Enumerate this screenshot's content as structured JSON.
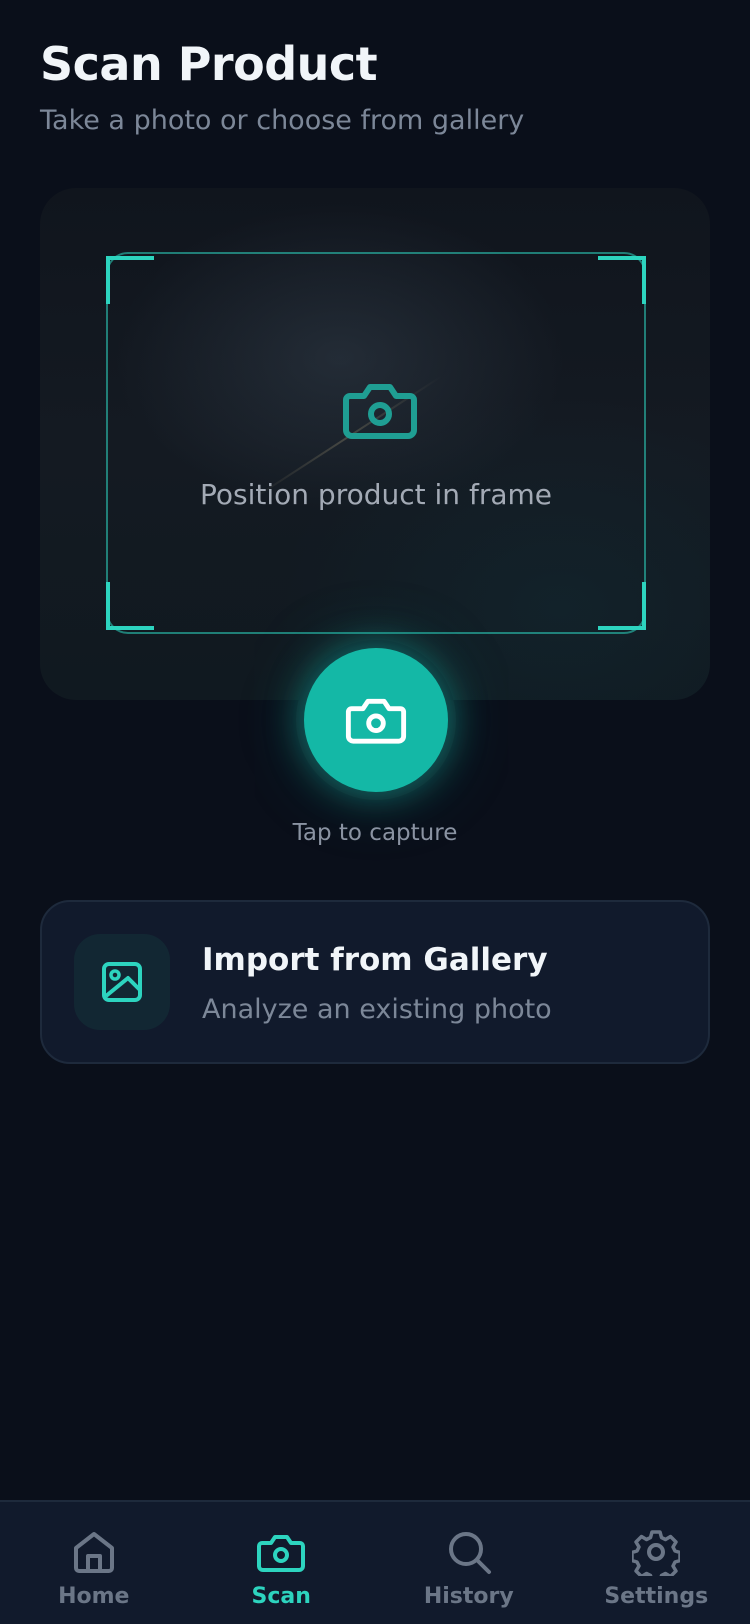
{
  "header": {
    "title": "Scan Product",
    "subtitle": "Take a photo or choose from gallery"
  },
  "viewfinder": {
    "hint": "Position product in frame",
    "frame_color": "#2dd4bf",
    "icon": "camera-icon"
  },
  "capture": {
    "label": "Tap to capture",
    "button_color": "#14b8a6",
    "icon": "camera-icon"
  },
  "import": {
    "title": "Import from Gallery",
    "subtitle": "Analyze an existing photo",
    "icon": "image-icon"
  },
  "nav": {
    "items": [
      {
        "label": "Home",
        "icon": "home-icon",
        "active": false
      },
      {
        "label": "Scan",
        "icon": "camera-icon",
        "active": true
      },
      {
        "label": "History",
        "icon": "search-icon",
        "active": false
      },
      {
        "label": "Settings",
        "icon": "gear-icon",
        "active": false
      }
    ],
    "active_color": "#2dd4bf",
    "inactive_color": "#6b7687"
  }
}
